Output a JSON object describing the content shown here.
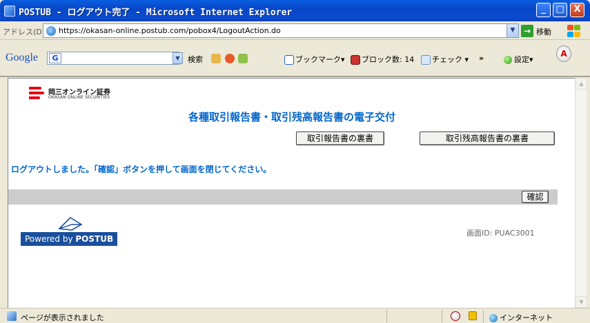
{
  "window": {
    "title": "POSTUB - ログアウト完了 - Microsoft Internet Explorer",
    "minimize_label": "_",
    "maximize_label": "□",
    "close_label": "X"
  },
  "addressbar": {
    "label": "アドレス(D)",
    "url": "https://okasan-online.postub.com/pobox4/LogoutAction.do",
    "dropdown": "▼",
    "go_label": "移動",
    "go_arrow": "→"
  },
  "toolbar": {
    "google_logo": "Google",
    "google_g": "G",
    "google_dropdown": "▼",
    "search_label": "検索",
    "bookmarks_label": "ブックマーク▾",
    "blocked_label": "ブロック数: 14",
    "check_label": "チェック ▾",
    "more_label": "»",
    "settings_label": "設定▾",
    "pdf_icon_text": "A"
  },
  "page": {
    "logo_jp": "岡三オンライン証券",
    "logo_en": "OKASAN ONLINE SECURITIES",
    "heading": "各種取引報告書・取引残高報告書の電子交付",
    "buttons": {
      "trade_report_back": "取引報告書の裏書",
      "balance_report_back": "取引残高報告書の裏書",
      "confirm": "確認"
    },
    "logout_message": "ログアウトしました。「確認」ボタンを押して画面を閉じてください。",
    "powered_prefix": "Powered by ",
    "powered_brand": "POSTUB",
    "screen_id": "画面ID: PUAC3001"
  },
  "scrollbar": {
    "up": "▲",
    "down": "▼"
  },
  "statusbar": {
    "text": "ページが表示されました",
    "zone": "インターネット"
  },
  "colors": {
    "heading_blue": "#0066cc",
    "logo_red": "#e60012",
    "postub_blue": "#1a4f9c",
    "gray_band": "#cccccc"
  }
}
